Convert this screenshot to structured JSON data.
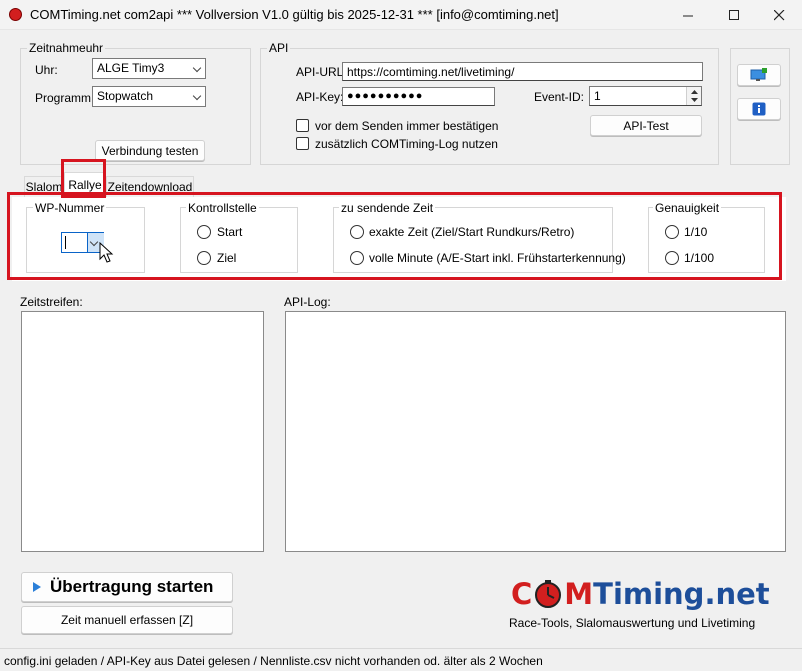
{
  "window": {
    "title": "COMTiming.net com2api *** Vollversion V1.0 gültig bis 2025-12-31 *** [info@comtiming.net]"
  },
  "zeitnahmeuhr": {
    "title": "Zeitnahmeuhr",
    "uhr_label": "Uhr:",
    "uhr_value": "ALGE Timy3",
    "programm_label": "Programm:",
    "programm_value": "Stopwatch",
    "test_button": "Verbindung testen"
  },
  "api": {
    "title": "API",
    "url_label": "API-URL:",
    "url_value": "https://comtiming.net/livetiming/",
    "key_label": "API-Key:",
    "key_value": "●●●●●●●●●●",
    "event_label": "Event-ID:",
    "event_value": "1",
    "confirm_label": "vor dem Senden immer bestätigen",
    "log_label": "zusätzlich COMTiming-Log nutzen",
    "test_button": "API-Test"
  },
  "tabs": [
    {
      "label": "Slalom"
    },
    {
      "label": "Rallye"
    },
    {
      "label": "Zeitendownload"
    }
  ],
  "rallye": {
    "wp_title": "WP-Nummer",
    "wp_value": "",
    "kontroll_title": "Kontrollstelle",
    "kontroll_options": [
      "Start",
      "Ziel"
    ],
    "zeit_title": "zu sendende Zeit",
    "zeit_options": [
      "exakte Zeit (Ziel/Start Rundkurs/Retro)",
      "volle Minute (A/E-Start inkl. Frühstarterkennung)"
    ],
    "genau_title": "Genauigkeit",
    "genau_options": [
      "1/10",
      "1/100"
    ]
  },
  "lists": {
    "zeitstreifen_label": "Zeitstreifen:",
    "apilog_label": "API-Log:"
  },
  "actions": {
    "start_button": "Übertragung starten",
    "manual_button": "Zeit manuell erfassen [Z]"
  },
  "logo": {
    "part1": "C",
    "part2": "M",
    "part3": "Timing.net",
    "tagline": "Race-Tools, Slalomauswertung und Livetiming"
  },
  "status": {
    "text": "config.ini geladen / API-Key aus Datei gelesen / Nennliste.csv  nicht vorhanden od. älter als 2 Wochen"
  },
  "colors": {
    "accent_red": "#d6141f",
    "logo_red": "#d21f1f",
    "logo_blue": "#1d4e9a"
  }
}
